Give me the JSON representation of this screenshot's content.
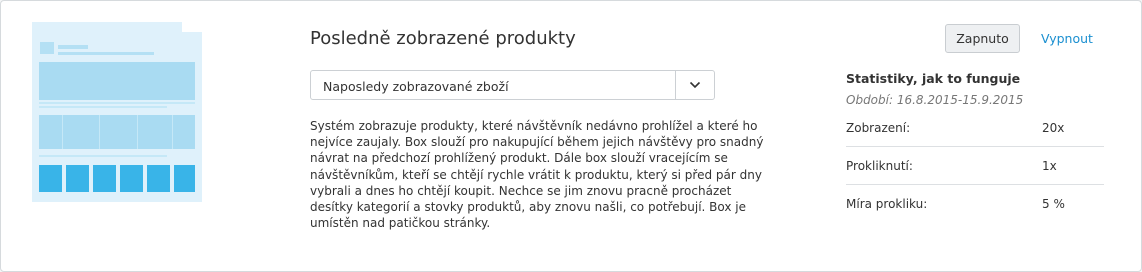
{
  "box": {
    "title": "Posledně zobrazené produkty",
    "select_value": "Naposledy zobrazované zboží",
    "description": "Systém zobrazuje produkty, které návštěvník nedávno prohlížel a které ho nejvíce zaujaly. Box slouží pro nakupující během jejich návštěvy pro snadný návrat na předchozí prohlížený produkt. Dále box slouží vracejícím se návštěvníkům, kteří se chtějí rychle vrátit k produktu, který si před pár dny vybrali a dnes ho chtějí koupit. Nechce se jim znovu pracně procházet desítky kategorií a stovky produktů, aby znovu našli, co potřebují. Box je umístěn nad patičkou stránky."
  },
  "actions": {
    "on_label": "Zapnuto",
    "off_label": "Vypnout"
  },
  "stats": {
    "title": "Statistiky, jak to funguje",
    "period": "Období: 16.8.2015-15.9.2015",
    "rows": [
      {
        "label": "Zobrazení:",
        "value": "20x"
      },
      {
        "label": "Prokliknutí:",
        "value": "1x"
      },
      {
        "label": "Míra prokliku:",
        "value": "5 %"
      }
    ]
  },
  "colors": {
    "accent": "#1a8fd0",
    "illustration_light": "#dff1fb",
    "illustration_mid": "#a9dbf2",
    "illustration_strong": "#39b4e8"
  },
  "icons": {
    "illustration": "page-layout-illustration",
    "select": "chevron-down-icon"
  }
}
